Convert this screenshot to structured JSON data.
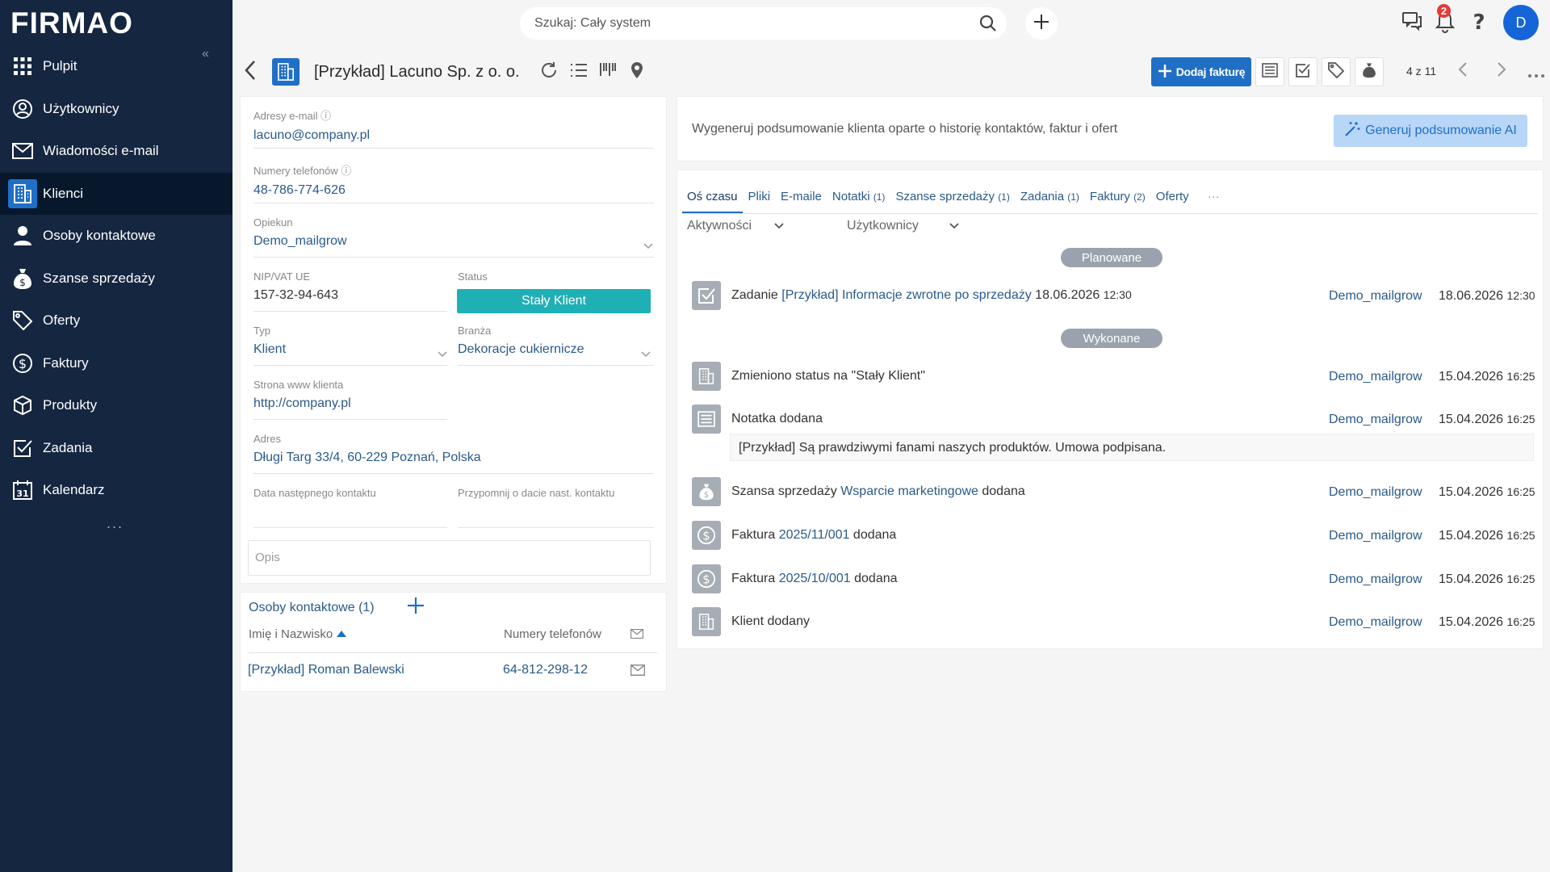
{
  "sidebar": {
    "logo": "FIRMAO",
    "collapse": "«",
    "items": [
      {
        "label": "Pulpit",
        "icon": "grid-icon"
      },
      {
        "label": "Użytkownicy",
        "icon": "users-icon"
      },
      {
        "label": "Wiadomości e-mail",
        "icon": "mail-icon"
      },
      {
        "label": "Klienci",
        "icon": "building-icon",
        "active": true
      },
      {
        "label": "Osoby kontaktowe",
        "icon": "person-icon"
      },
      {
        "label": "Szanse sprzedaży",
        "icon": "moneybag-icon"
      },
      {
        "label": "Oferty",
        "icon": "tag-icon"
      },
      {
        "label": "Faktury",
        "icon": "dollar-icon"
      },
      {
        "label": "Produkty",
        "icon": "box-icon"
      },
      {
        "label": "Zadania",
        "icon": "checkbox-icon"
      },
      {
        "label": "Kalendarz",
        "icon": "calendar-icon"
      }
    ],
    "more": "..."
  },
  "topbar": {
    "search_placeholder": "Szukaj: Cały system",
    "notification_count": "2",
    "avatar_initial": "D"
  },
  "header": {
    "title": "[Przykład] Lacuno Sp. z o. o.",
    "add_invoice_label": "Dodaj fakturę",
    "pager": "4 z 11"
  },
  "client": {
    "email_label": "Adresy e-mail",
    "email": "lacuno@company.pl",
    "phone_label": "Numery telefonów",
    "phone": "48-786-774-626",
    "owner_label": "Opiekun",
    "owner": "Demo_mailgrow",
    "nip_label": "NIP/VAT UE",
    "nip": "157-32-94-643",
    "status_label": "Status",
    "status": "Stały Klient",
    "type_label": "Typ",
    "type": "Klient",
    "industry_label": "Branża",
    "industry": "Dekoracje cukiernicze",
    "website_label": "Strona www klienta",
    "website": "http://company.pl",
    "address_label": "Adres",
    "address": "Długi Targ 33/4, 60-229 Poznań, Polska",
    "next_contact_label": "Data następnego kontaktu",
    "remind_label": "Przypomnij o dacie nast. kontaktu",
    "description_placeholder": "Opis"
  },
  "contacts": {
    "title": "Osoby kontaktowe (1)",
    "col_name": "Imię i Nazwisko",
    "col_phone": "Numery telefonów",
    "rows": [
      {
        "name": "[Przykład] Roman Balewski",
        "phone": "64-812-298-12"
      }
    ]
  },
  "ai": {
    "text": "Wygeneruj podsumowanie klienta oparte o historię kontaktów, faktur i ofert",
    "button": "Generuj podsumowanie AI"
  },
  "tabs": [
    {
      "label": "Oś czasu",
      "count": ""
    },
    {
      "label": "Pliki",
      "count": ""
    },
    {
      "label": "E-maile",
      "count": ""
    },
    {
      "label": "Notatki",
      "count": "(1)"
    },
    {
      "label": "Szanse sprzedaży",
      "count": "(1)"
    },
    {
      "label": "Zadania",
      "count": "(1)"
    },
    {
      "label": "Faktury",
      "count": "(2)"
    },
    {
      "label": "Oferty",
      "count": ""
    },
    {
      "label": "···",
      "count": ""
    }
  ],
  "filters": {
    "activities": "Aktywności",
    "users": "Użytkownicy"
  },
  "timeline": {
    "planned_label": "Planowane",
    "done_label": "Wykonane",
    "planned": [
      {
        "pre": "Zadanie ",
        "link": "[Przykład] Informacje zwrotne po sprzedaży",
        "post": " 18.06.2026 ",
        "time": "12:30",
        "user": "Demo_mailgrow",
        "date": "18.06.2026",
        "dtime": "12:30",
        "icon": "task-icon"
      }
    ],
    "done": [
      {
        "pre": "Zmieniono status na \"Stały Klient\"",
        "link": "",
        "post": "",
        "time": "",
        "user": "Demo_mailgrow",
        "date": "15.04.2026",
        "dtime": "16:25",
        "icon": "building-icon"
      },
      {
        "pre": "Notatka dodana",
        "link": "",
        "post": "",
        "time": "",
        "user": "Demo_mailgrow",
        "date": "15.04.2026",
        "dtime": "16:25",
        "icon": "note-icon",
        "note": "[Przykład] Są prawdziwymi fanami naszych produktów. Umowa podpisana."
      },
      {
        "pre": "Szansa sprzedaży ",
        "link": "Wsparcie marketingowe",
        "post": " dodana",
        "time": "",
        "user": "Demo_mailgrow",
        "date": "15.04.2026",
        "dtime": "16:25",
        "icon": "moneybag-icon"
      },
      {
        "pre": "Faktura ",
        "link": "2025/11/001",
        "post": " dodana",
        "time": "",
        "user": "Demo_mailgrow",
        "date": "15.04.2026",
        "dtime": "16:25",
        "icon": "dollar-icon"
      },
      {
        "pre": "Faktura ",
        "link": "2025/10/001",
        "post": " dodana",
        "time": "",
        "user": "Demo_mailgrow",
        "date": "15.04.2026",
        "dtime": "16:25",
        "icon": "dollar-icon"
      },
      {
        "pre": "Klient dodany",
        "link": "",
        "post": "",
        "time": "",
        "user": "Demo_mailgrow",
        "date": "15.04.2026",
        "dtime": "16:25",
        "icon": "building-icon"
      }
    ]
  },
  "colors": {
    "sidebar_bg": "#142640",
    "accent": "#1f6fc6",
    "status": "#1fb0b5"
  }
}
